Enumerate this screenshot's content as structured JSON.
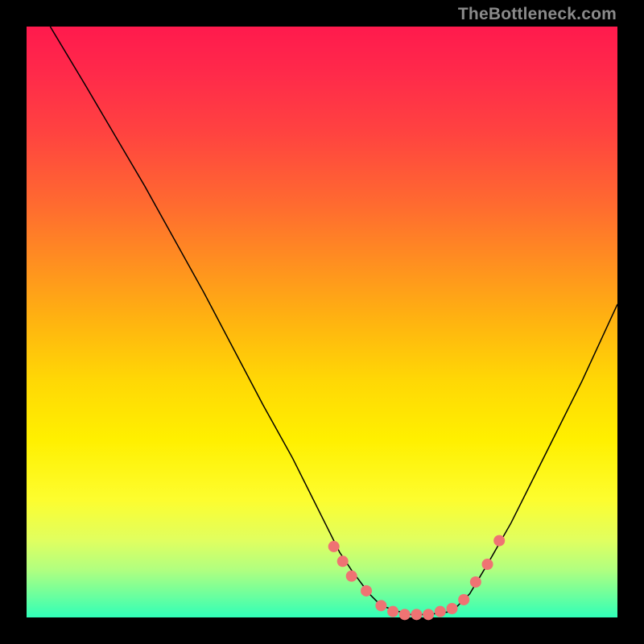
{
  "watermark": "TheBottleneck.com",
  "chart_data": {
    "type": "line",
    "title": "",
    "xlabel": "",
    "ylabel": "",
    "xlim": [
      0,
      100
    ],
    "ylim": [
      0,
      100
    ],
    "curve": {
      "x": [
        4,
        10,
        20,
        30,
        40,
        45,
        50,
        53,
        55,
        58,
        60,
        63,
        65,
        68,
        72,
        75,
        78,
        82,
        88,
        94,
        100
      ],
      "y": [
        100,
        90,
        73,
        55,
        36,
        27,
        17,
        11,
        8,
        4,
        2,
        1,
        0.5,
        0.5,
        1,
        4,
        9,
        16,
        28,
        40,
        53
      ]
    },
    "dots": {
      "x": [
        52,
        53.5,
        55,
        57.5,
        60,
        62,
        64,
        66,
        68,
        70,
        72,
        74,
        76,
        78,
        80
      ],
      "y": [
        12,
        9.5,
        7,
        4.5,
        2,
        1,
        0.5,
        0.5,
        0.5,
        1,
        1.5,
        3,
        6,
        9,
        13
      ]
    },
    "dot_radius": 7,
    "colors": {
      "curve": "#000000",
      "dots": "#ef7373",
      "gradient_top": "#ff1a4d",
      "gradient_bottom": "#30ffb8"
    }
  }
}
